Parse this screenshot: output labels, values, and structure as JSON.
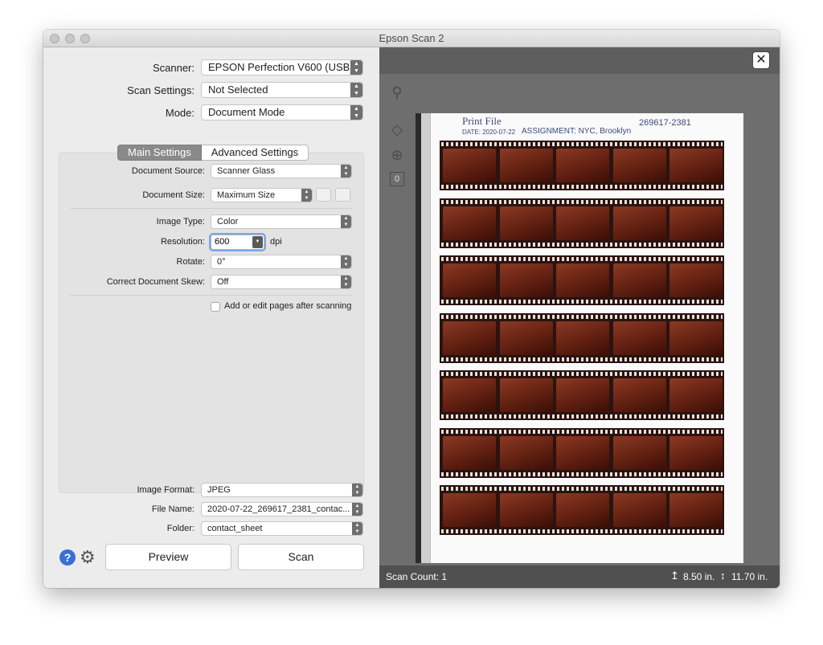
{
  "window": {
    "title": "Epson Scan 2"
  },
  "top": {
    "scanner": {
      "label": "Scanner:",
      "value": "EPSON Perfection V600 (USB)"
    },
    "scan_settings": {
      "label": "Scan Settings:",
      "value": "Not Selected"
    },
    "mode": {
      "label": "Mode:",
      "value": "Document Mode"
    }
  },
  "tabs": {
    "main": "Main Settings",
    "advanced": "Advanced Settings"
  },
  "main_settings": {
    "document_source": {
      "label": "Document Source:",
      "value": "Scanner Glass"
    },
    "document_size": {
      "label": "Document Size:",
      "value": "Maximum Size"
    },
    "image_type": {
      "label": "Image Type:",
      "value": "Color"
    },
    "resolution": {
      "label": "Resolution:",
      "value": "600",
      "unit": "dpi"
    },
    "rotate": {
      "label": "Rotate:",
      "value": "0°"
    },
    "skew": {
      "label": "Correct Document Skew:",
      "value": "Off"
    },
    "add_pages": {
      "label": "Add or edit pages after scanning",
      "checked": false
    }
  },
  "output": {
    "image_format": {
      "label": "Image Format:",
      "value": "JPEG"
    },
    "file_name": {
      "label": "File Name:",
      "value": "2020-07-22_269617_2381_contac..."
    },
    "folder": {
      "label": "Folder:",
      "value": "contact_sheet"
    }
  },
  "buttons": {
    "preview": "Preview",
    "scan": "Scan"
  },
  "preview_panel": {
    "close_glyph": "✕",
    "page_count": "0",
    "status": {
      "scan_count": "Scan Count: 1",
      "width": "8.50 in.",
      "height": "11.70 in."
    },
    "sheet": {
      "brand": "Print File",
      "date": "DATE: 2020-07-22",
      "assignment": "ASSIGNMENT: NYC, Brooklyn",
      "number": "269617-2381"
    },
    "strip_count": 7,
    "frames_per_strip": 5
  },
  "colors": {
    "accent": "#3b6ed8",
    "film": "#6a2414",
    "pane_dark": "#6e6e6e"
  }
}
